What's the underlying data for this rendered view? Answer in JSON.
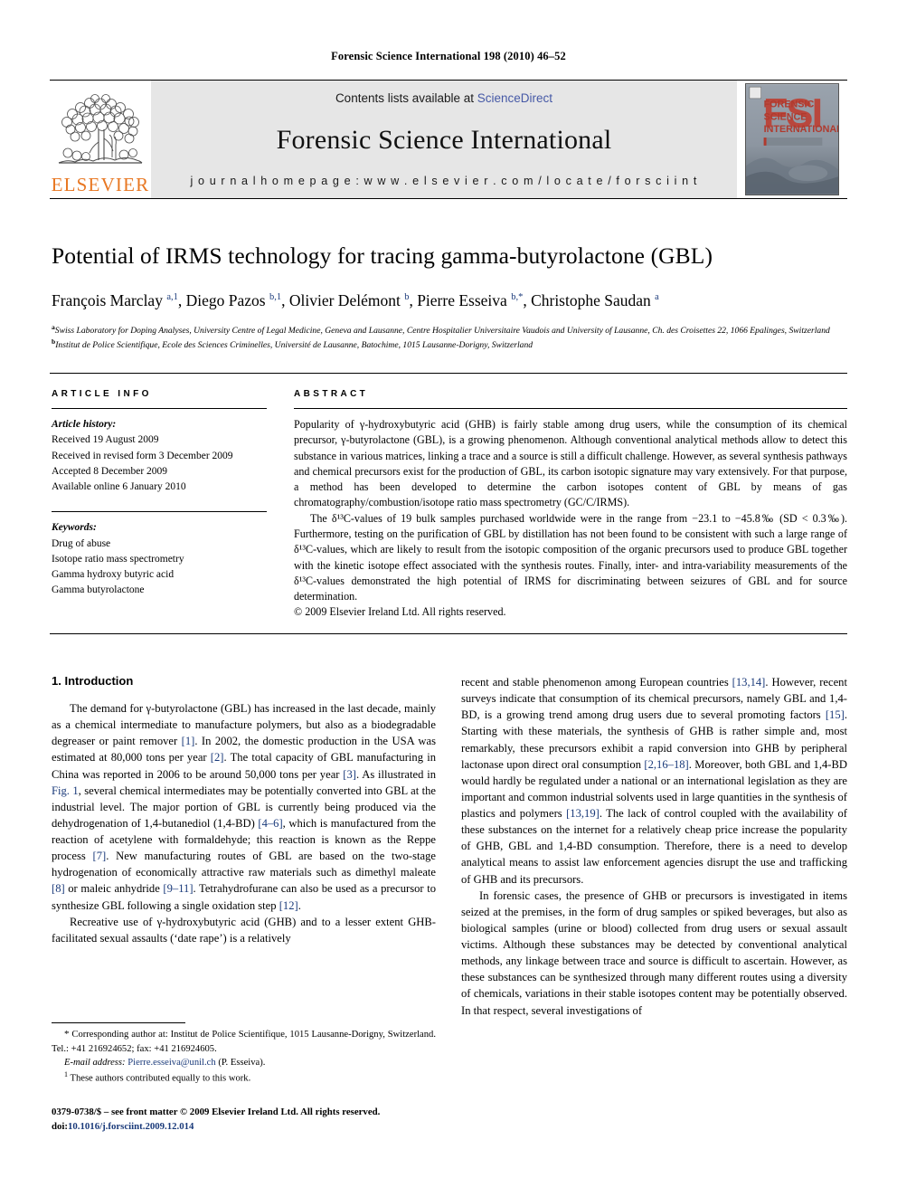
{
  "running_head": "Forensic Science International 198 (2010) 46–52",
  "masthead": {
    "contents_prefix": "Contents lists available at ",
    "sciencedirect": "ScienceDirect",
    "journal_title": "Forensic Science International",
    "homepage": "j o u r n a l   h o m e p a g e :   w w w . e l s e v i e r . c o m / l o c a t e / f o r s c i i n t",
    "elsevier_word": "ELSEVIER",
    "cover_lines": [
      "FORENSIC",
      "SCIENCE",
      "INTERNATIONAL"
    ],
    "cover_mark": "FSI",
    "accent_orange": "#E87722",
    "link_blue": "#4659a6"
  },
  "title": "Potential of IRMS technology for tracing gamma-butyrolactone (GBL)",
  "authors_html": "François Marclay <sup>a,1</sup>, Diego Pazos <sup>b,1</sup>, Olivier Delémont <sup>b</sup>, Pierre Esseiva <sup>b,*</sup>, Christophe Saudan <sup>a</sup>",
  "affiliations": [
    {
      "marker": "a",
      "text": "Swiss Laboratory for Doping Analyses, University Centre of Legal Medicine, Geneva and Lausanne, Centre Hospitalier Universitaire Vaudois and University of Lausanne, Ch. des Croisettes 22, 1066 Epalinges, Switzerland"
    },
    {
      "marker": "b",
      "text": "Institut de Police Scientifique, Ecole des Sciences Criminelles, Université de Lausanne, Batochime, 1015 Lausanne-Dorigny, Switzerland"
    }
  ],
  "article_info": {
    "heading": "ARTICLE INFO",
    "history_label": "Article history:",
    "history": [
      "Received 19 August 2009",
      "Received in revised form 3 December 2009",
      "Accepted 8 December 2009",
      "Available online 6 January 2010"
    ],
    "keywords_label": "Keywords:",
    "keywords": [
      "Drug of abuse",
      "Isotope ratio mass spectrometry",
      "Gamma hydroxy butyric acid",
      "Gamma butyrolactone"
    ]
  },
  "abstract": {
    "heading": "ABSTRACT",
    "paragraph1": "Popularity of γ-hydroxybutyric acid (GHB) is fairly stable among drug users, while the consumption of its chemical precursor, γ-butyrolactone (GBL), is a growing phenomenon. Although conventional analytical methods allow to detect this substance in various matrices, linking a trace and a source is still a difficult challenge. However, as several synthesis pathways and chemical precursors exist for the production of GBL, its carbon isotopic signature may vary extensively. For that purpose, a method has been developed to determine the carbon isotopes content of GBL by means of gas chromatography/combustion/isotope ratio mass spectrometry (GC/C/IRMS).",
    "paragraph2": "The δ¹³C-values of 19 bulk samples purchased worldwide were in the range from −23.1 to −45.8‰ (SD < 0.3‰). Furthermore, testing on the purification of GBL by distillation has not been found to be consistent with such a large range of δ¹³C-values, which are likely to result from the isotopic composition of the organic precursors used to produce GBL together with the kinetic isotope effect associated with the synthesis routes. Finally, inter- and intra-variability measurements of the δ¹³C-values demonstrated the high potential of IRMS for discriminating between seizures of GBL and for source determination.",
    "copyright": "© 2009 Elsevier Ireland Ltd. All rights reserved."
  },
  "sections": {
    "intro_heading": "1. Introduction",
    "left_paragraphs": [
      "The demand for γ-butyrolactone (GBL) has increased in the last decade, mainly as a chemical intermediate to manufacture polymers, but also as a biodegradable degreaser or paint remover [1]. In 2002, the domestic production in the USA was estimated at 80,000 tons per year [2]. The total capacity of GBL manufacturing in China was reported in 2006 to be around 50,000 tons per year [3]. As illustrated in Fig. 1, several chemical intermediates may be potentially converted into GBL at the industrial level. The major portion of GBL is currently being produced via the dehydrogenation of 1,4-butanediol (1,4-BD) [4–6], which is manufactured from the reaction of acetylene with formaldehyde; this reaction is known as the Reppe process [7]. New manufacturing routes of GBL are based on the two-stage hydrogenation of economically attractive raw materials such as dimethyl maleate [8] or maleic anhydride [9–11]. Tetrahydrofurane can also be used as a precursor to synthesize GBL following a single oxidation step [12].",
      "Recreative use of γ-hydroxybutyric acid (GHB) and to a lesser extent GHB-facilitated sexual assaults (‘date rape’) is a relatively"
    ],
    "right_paragraphs": [
      "recent and stable phenomenon among European countries [13,14]. However, recent surveys indicate that consumption of its chemical precursors, namely GBL and 1,4-BD, is a growing trend among drug users due to several promoting factors [15]. Starting with these materials, the synthesis of GHB is rather simple and, most remarkably, these precursors exhibit a rapid conversion into GHB by peripheral lactonase upon direct oral consumption [2,16–18]. Moreover, both GBL and 1,4-BD would hardly be regulated under a national or an international legislation as they are important and common industrial solvents used in large quantities in the synthesis of plastics and polymers [13,19]. The lack of control coupled with the availability of these substances on the internet for a relatively cheap price increase the popularity of GHB, GBL and 1,4-BD consumption. Therefore, there is a need to develop analytical means to assist law enforcement agencies disrupt the use and trafficking of GHB and its precursors.",
      "In forensic cases, the presence of GHB or precursors is investigated in items seized at the premises, in the form of drug samples or spiked beverages, but also as biological samples (urine or blood) collected from drug users or sexual assault victims. Although these substances may be detected by conventional analytical methods, any linkage between trace and source is difficult to ascertain. However, as these substances can be synthesized through many different routes using a diversity of chemicals, variations in their stable isotopes content may be potentially observed. In that respect, several investigations of"
    ]
  },
  "footnotes": {
    "corresponding": "Corresponding author at: Institut de Police Scientifique, 1015 Lausanne-Dorigny, Switzerland. Tel.: +41 216924652; fax: +41 216924605.",
    "email_label": "E-mail address:",
    "email": "Pierre.esseiva@unil.ch",
    "email_suffix": "(P. Esseiva).",
    "equal_contrib": "These authors contributed equally to this work."
  },
  "imprint": {
    "line1": "0379-0738/$ – see front matter © 2009 Elsevier Ireland Ltd. All rights reserved.",
    "doi_label": "doi:",
    "doi": "10.1016/j.forsciint.2009.12.014"
  }
}
